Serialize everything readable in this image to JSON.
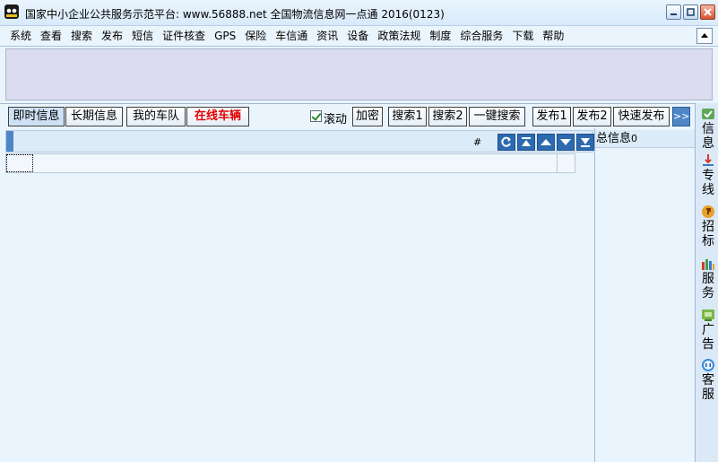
{
  "window": {
    "title": "国家中小企业公共服务示范平台: www.56888.net 全国物流信息网一点通 2016(0123)"
  },
  "menu": {
    "items": [
      "系统",
      "查看",
      "搜索",
      "发布",
      "短信",
      "证件核查",
      "GPS",
      "保险",
      "车信通",
      "资讯",
      "设备",
      "政策法规",
      "制度",
      "综合服务",
      "下载",
      "帮助"
    ]
  },
  "toolbar": {
    "tab_instant": "即时信息",
    "tab_longterm": "长期信息",
    "tab_myfleet": "我的车队",
    "tab_online": "在线车辆",
    "scroll_label": "滚动",
    "scroll_checked": true,
    "encrypt": "加密",
    "search1": "搜索1",
    "search2": "搜索2",
    "one_key_search": "一键搜索",
    "publish1": "发布1",
    "publish2": "发布2",
    "quick_publish": "快速发布",
    "more": ">>"
  },
  "grid": {
    "hash_header": "#"
  },
  "summary": {
    "label": "总信息",
    "count": "0"
  },
  "sidebar": {
    "items": [
      {
        "label": "信息",
        "icon": "info-icon"
      },
      {
        "label": "专线",
        "icon": "route-icon"
      },
      {
        "label": "招标",
        "icon": "bid-icon"
      },
      {
        "label": "服务",
        "icon": "service-icon"
      },
      {
        "label": "广告",
        "icon": "ad-icon"
      },
      {
        "label": "客服",
        "icon": "customer-service-icon"
      }
    ]
  },
  "colors": {
    "accent": "#4f86c8",
    "online_vehicles": "#e00000",
    "background": "#eaf4fd"
  }
}
